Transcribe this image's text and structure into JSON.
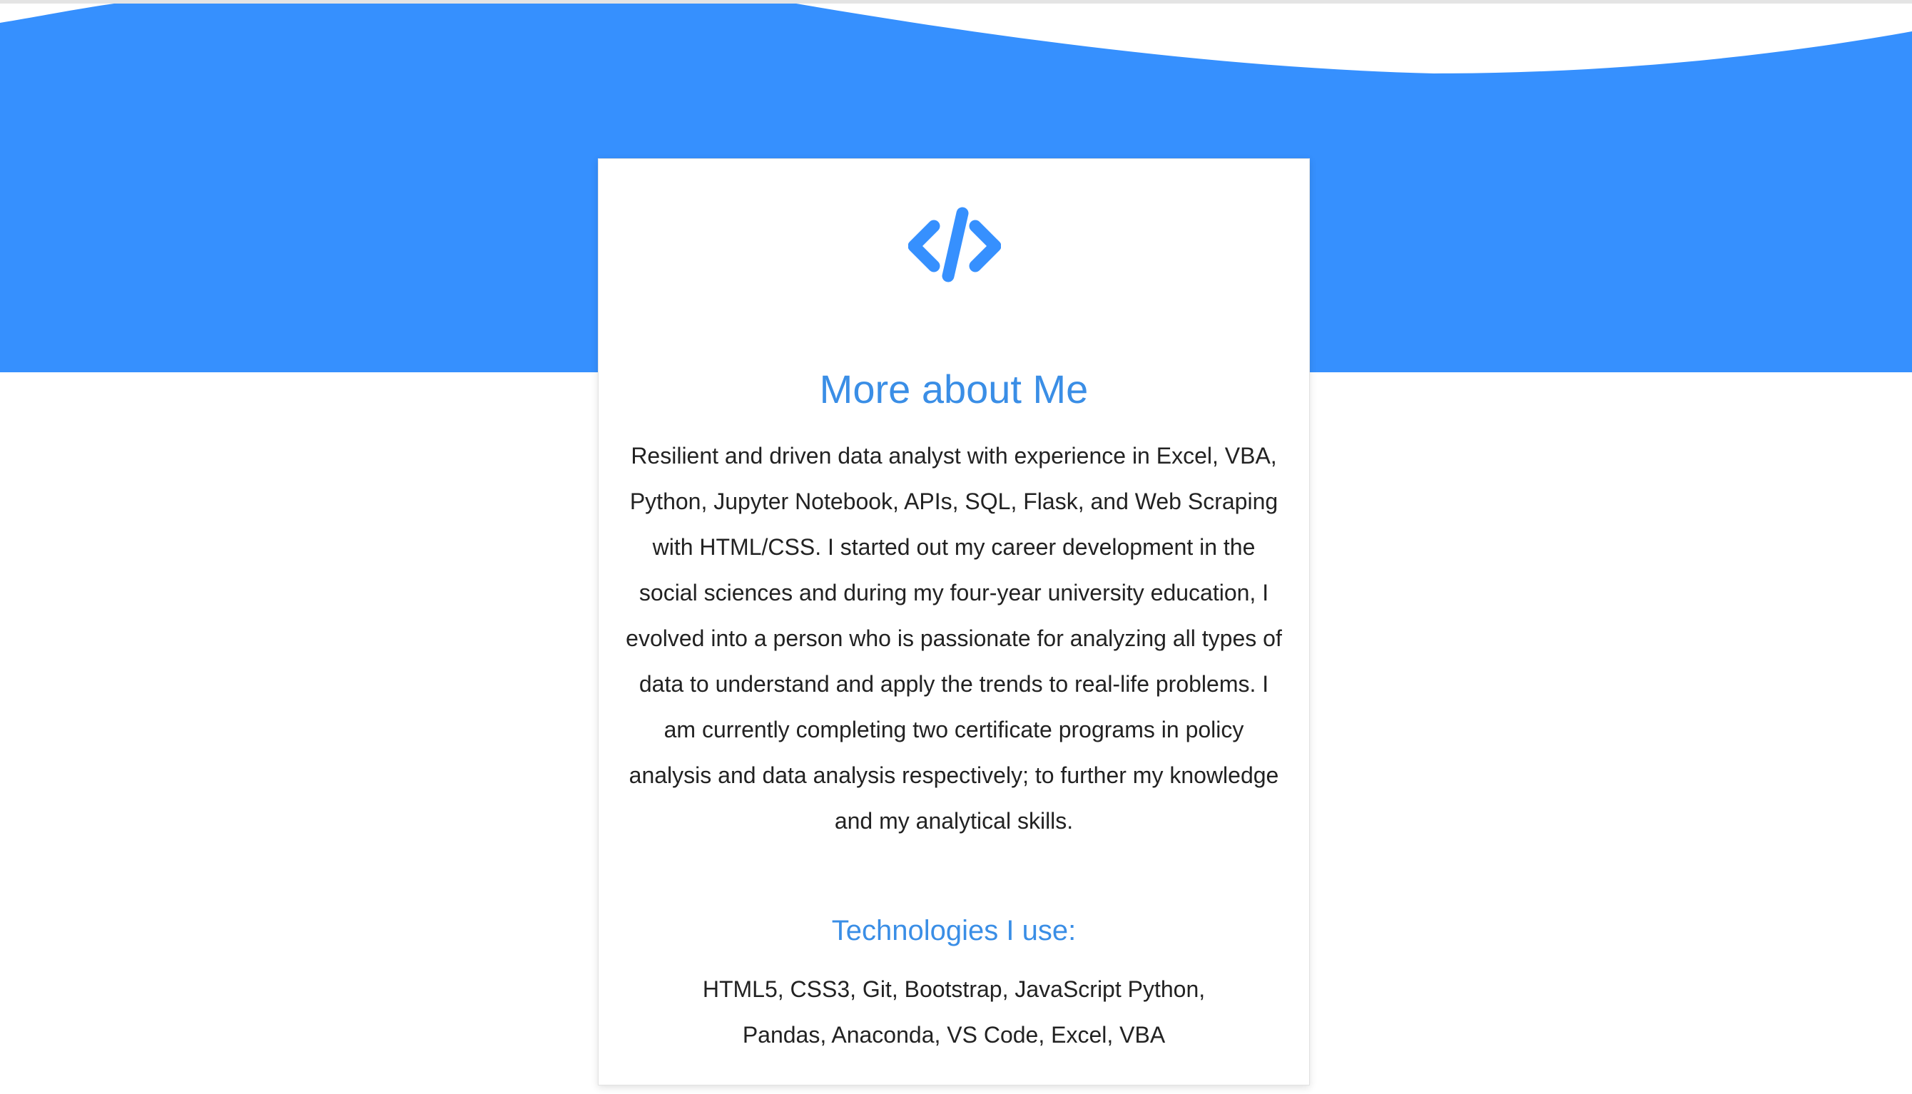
{
  "colors": {
    "accent": "#3690fe",
    "heading": "#3a8ee6",
    "text": "#222222",
    "background": "#ffffff"
  },
  "hero": {
    "icon": "code-icon"
  },
  "about": {
    "title": "More about Me",
    "text": "Resilient and driven data analyst with experience in Excel, VBA, Python, Jupyter Notebook, APIs, SQL, Flask, and Web Scraping with HTML/CSS. I started out my career development in the social sciences and during my four-year university education, I evolved into a person who is passionate for analyzing all types of data to understand and apply the trends to real-life problems. I am currently completing two certificate programs in policy analysis and data analysis respectively; to further my knowledge and my analytical skills."
  },
  "technologies": {
    "title": "Technologies I use:",
    "text": "HTML5, CSS3, Git, Bootstrap, JavaScript Python, Pandas, Anaconda, VS Code, Excel, VBA"
  }
}
